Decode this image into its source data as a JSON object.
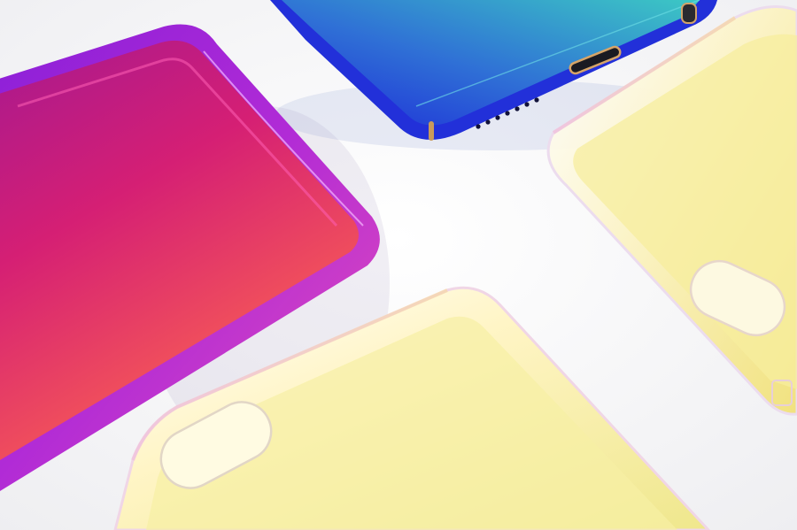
{
  "scene": {
    "subject": "four-gradient-phone-cases",
    "background_color": "#f6f6f8",
    "cases": [
      {
        "name": "case-magenta-orange",
        "colors": [
          "#c8157f",
          "#e0306a",
          "#ff7a3a",
          "#7a1fd8"
        ]
      },
      {
        "name": "case-blue-teal",
        "colors": [
          "#1b2fd6",
          "#2e78d8",
          "#34c4c8",
          "#d4a060"
        ]
      },
      {
        "name": "case-clear-yellow-right",
        "colors": [
          "#ffffff",
          "#fbf4c4",
          "#f4ea8e",
          "#f3c7d6"
        ]
      },
      {
        "name": "case-clear-yellow-bottom",
        "colors": [
          "#ffffff",
          "#fff7c8",
          "#f3ee96",
          "#f3c4dc"
        ]
      }
    ]
  }
}
